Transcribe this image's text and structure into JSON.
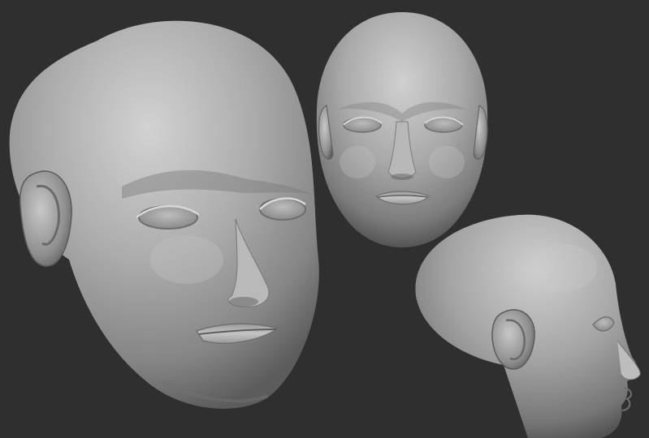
{
  "scene": {
    "background_color": "#2f2f2f",
    "clay_base_color": "#a9a9a9",
    "clay_highlight_color": "#d4d4d4",
    "clay_shadow_color": "#5a5a5a",
    "views": [
      {
        "id": "three-quarter",
        "description_name": "three-quarter-head-view"
      },
      {
        "id": "front",
        "description_name": "front-head-view"
      },
      {
        "id": "profile",
        "description_name": "profile-head-view"
      }
    ]
  }
}
